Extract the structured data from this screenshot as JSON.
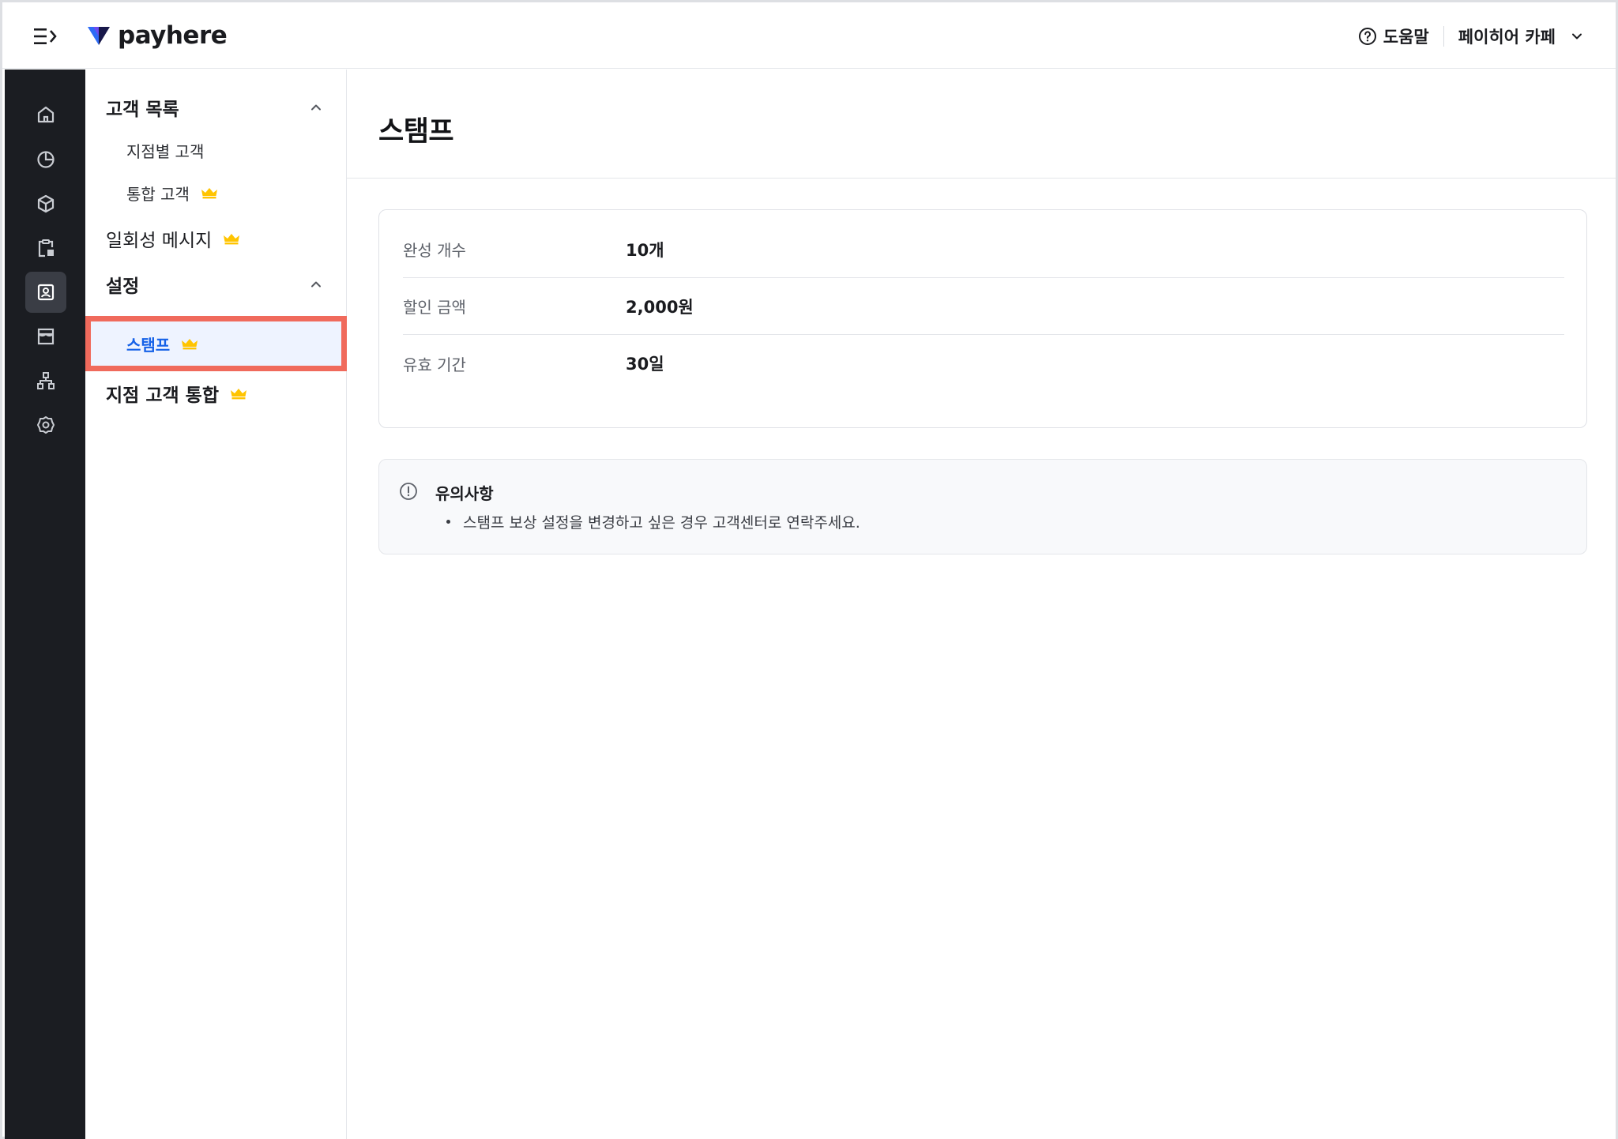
{
  "header": {
    "brand": "payhere",
    "help_label": "도움말",
    "store_name": "페이히어 카페"
  },
  "rail": {
    "items": [
      {
        "icon": "home-icon",
        "active": false
      },
      {
        "icon": "pie-chart-icon",
        "active": false
      },
      {
        "icon": "cube-icon",
        "active": false
      },
      {
        "icon": "clipboard-icon",
        "active": false
      },
      {
        "icon": "customer-card-icon",
        "active": true
      },
      {
        "icon": "store-icon",
        "active": false
      },
      {
        "icon": "org-chart-icon",
        "active": false
      },
      {
        "icon": "gear-icon",
        "active": false
      }
    ]
  },
  "subnav": {
    "customer_list": {
      "label": "고객 목록",
      "items": [
        {
          "label": "지점별 고객",
          "premium": false
        },
        {
          "label": "통합 고객",
          "premium": true
        }
      ]
    },
    "one_time_message": {
      "label": "일회성 메시지",
      "premium": true
    },
    "settings": {
      "label": "설정",
      "items": [
        {
          "label": "스탬프",
          "premium": true,
          "selected": true
        }
      ]
    },
    "branch_merge": {
      "label": "지점 고객 통합",
      "premium": true
    }
  },
  "main": {
    "title": "스탬프",
    "details": [
      {
        "label": "완성 개수",
        "value": "10개"
      },
      {
        "label": "할인 금액",
        "value": "2,000원"
      },
      {
        "label": "유효 기간",
        "value": "30일"
      }
    ],
    "notice": {
      "title": "유의사항",
      "items": [
        "스탬프 보상 설정을 변경하고 싶은 경우 고객센터로 연락주세요."
      ]
    }
  },
  "colors": {
    "rail_bg": "#1b1d22",
    "accent_blue": "#1662e8",
    "highlight_border": "#f06a5c",
    "crown": "#ffc400"
  }
}
